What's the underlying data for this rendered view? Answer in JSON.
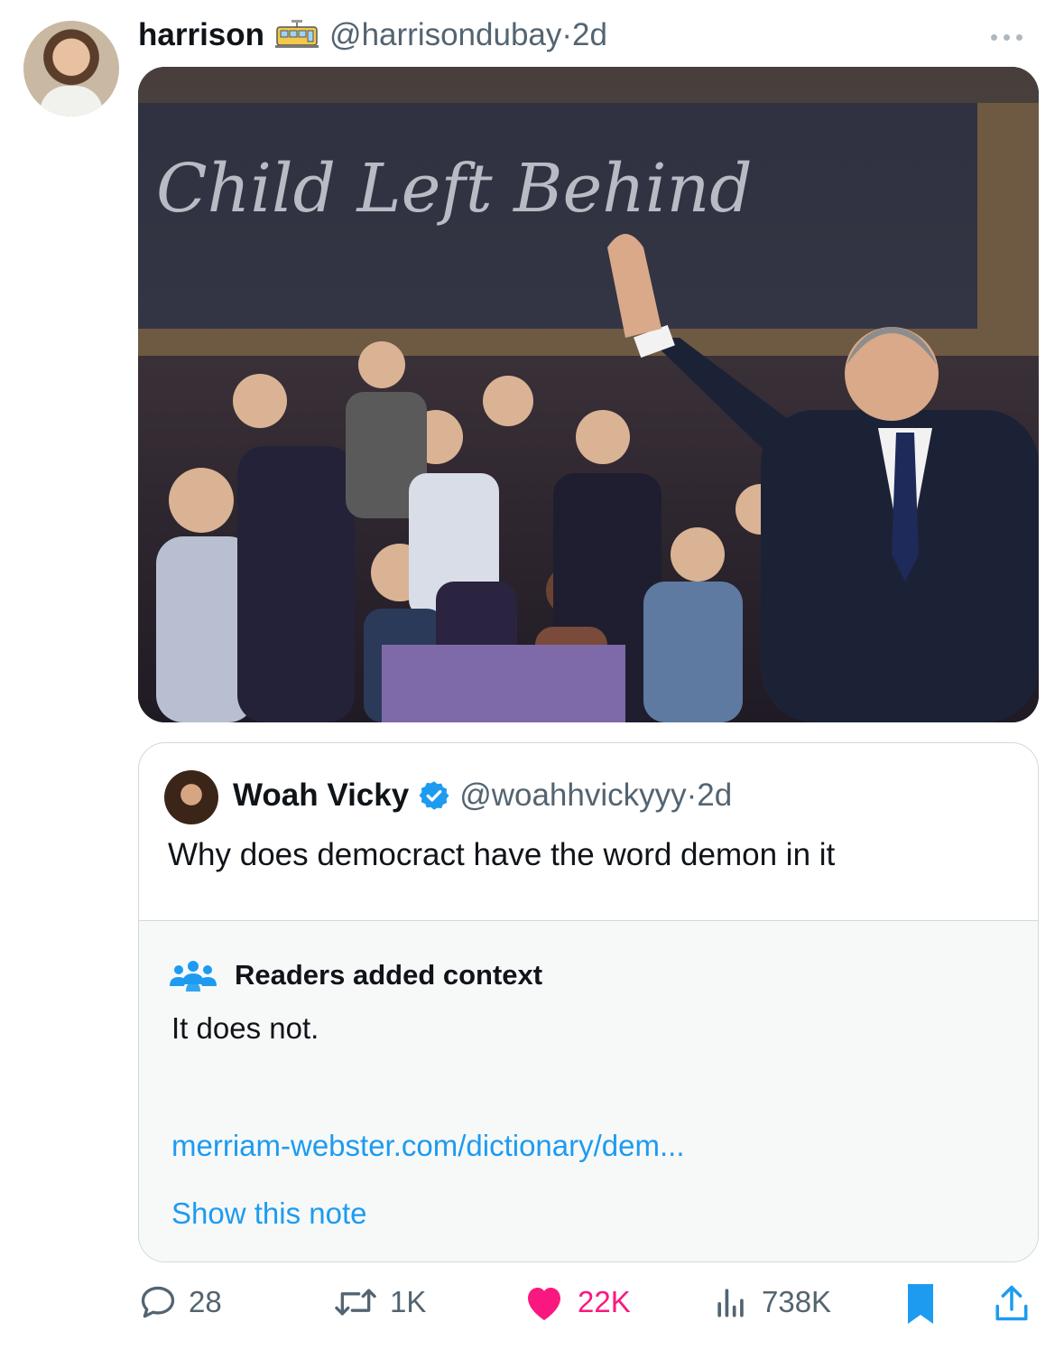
{
  "post": {
    "author_name": "harrison",
    "author_emoji": "tram-car-icon",
    "author_handle": "@harrisondubay",
    "separator": " · ",
    "time": "2d",
    "image_text": "Child Left Behind"
  },
  "quote": {
    "author_name": "Woah Vicky",
    "author_handle": "@woahhvickyyy",
    "separator": " · ",
    "time": "2d",
    "text": "Why does democract have the word demon in it"
  },
  "note": {
    "title": "Readers added context",
    "body": "It does not.",
    "link": "merriam-webster.com/dictionary/dem...",
    "show_label": "Show this note"
  },
  "actions": {
    "replies": "28",
    "reposts": "1K",
    "likes": "22K",
    "views": "738K"
  },
  "colors": {
    "accent": "#1d9bf0",
    "like": "#f91880",
    "muted": "#536471"
  }
}
